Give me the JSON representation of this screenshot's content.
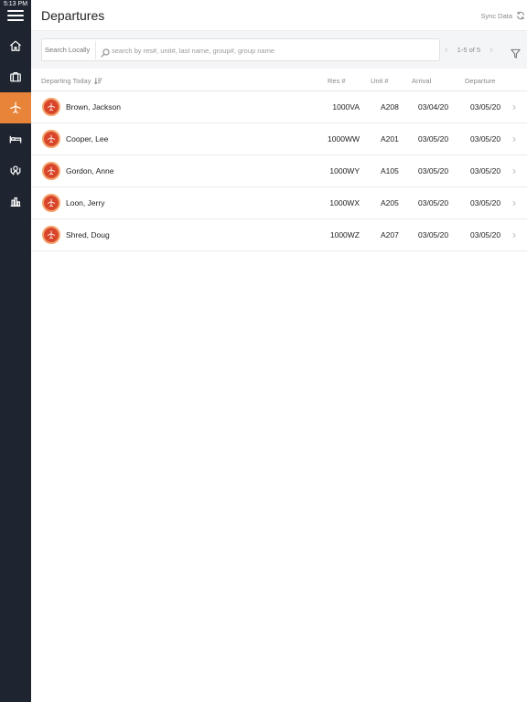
{
  "status_bar": {
    "time": "5:13 PM"
  },
  "sidebar": {
    "items": [
      {
        "icon": "home-icon",
        "active": false
      },
      {
        "icon": "suitcase-icon",
        "active": false
      },
      {
        "icon": "airplane-icon",
        "active": true
      },
      {
        "icon": "bed-icon",
        "active": false
      },
      {
        "icon": "hands-icon",
        "active": false
      },
      {
        "icon": "bar-chart-icon",
        "active": false
      }
    ],
    "active_color": "#e8843a",
    "background_color": "#1f2530"
  },
  "header": {
    "title": "Departures",
    "sync_label": "Sync Data"
  },
  "search": {
    "label": "Search Locally",
    "placeholder": "search by res#, unit#, last name, group#, group name",
    "value": ""
  },
  "pager": {
    "text": "1-5 of 5"
  },
  "table": {
    "headers": {
      "name": "Departing Today",
      "res": "Res #",
      "unit": "Unit #",
      "arrival": "Arrival",
      "departure": "Departure"
    },
    "rows": [
      {
        "name": "Brown, Jackson",
        "res": "1000VA",
        "unit": "A208",
        "arrival": "03/04/20",
        "departure": "03/05/20"
      },
      {
        "name": "Cooper, Lee",
        "res": "1000WW",
        "unit": "A201",
        "arrival": "03/05/20",
        "departure": "03/05/20"
      },
      {
        "name": "Gordon, Anne",
        "res": "1000WY",
        "unit": "A105",
        "arrival": "03/05/20",
        "departure": "03/05/20"
      },
      {
        "name": "Loon, Jerry",
        "res": "1000WX",
        "unit": "A205",
        "arrival": "03/05/20",
        "departure": "03/05/20"
      },
      {
        "name": "Shred, Doug",
        "res": "1000WZ",
        "unit": "A207",
        "arrival": "03/05/20",
        "departure": "03/05/20"
      }
    ]
  }
}
